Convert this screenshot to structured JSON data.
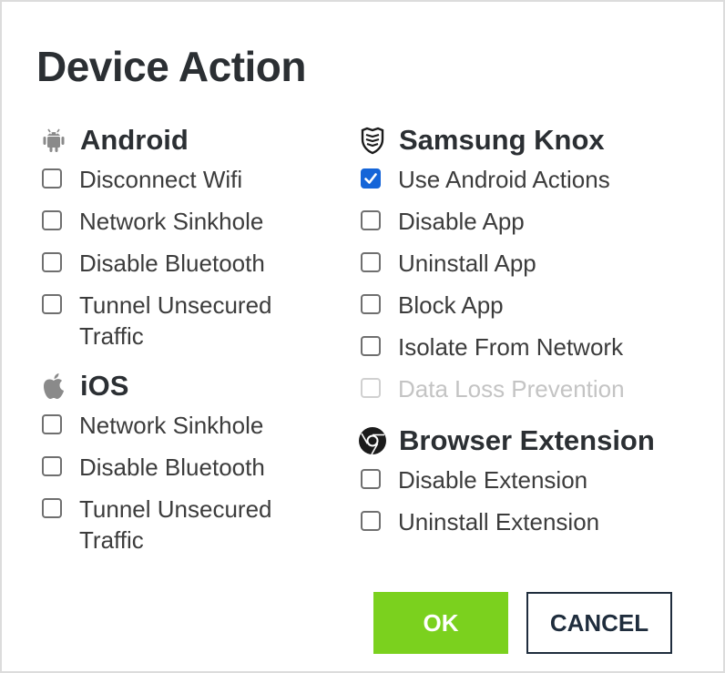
{
  "dialog": {
    "title": "Device Action"
  },
  "android": {
    "title": "Android",
    "icon": "android-icon",
    "items": [
      {
        "label": "Disconnect Wifi",
        "checked": false,
        "disabled": false
      },
      {
        "label": "Network Sinkhole",
        "checked": false,
        "disabled": false
      },
      {
        "label": "Disable Bluetooth",
        "checked": false,
        "disabled": false
      },
      {
        "label": "Tunnel Unsecured Traffic",
        "checked": false,
        "disabled": false
      }
    ]
  },
  "ios": {
    "title": "iOS",
    "icon": "apple-icon",
    "items": [
      {
        "label": "Network Sinkhole",
        "checked": false,
        "disabled": false
      },
      {
        "label": "Disable Bluetooth",
        "checked": false,
        "disabled": false
      },
      {
        "label": "Tunnel Unsecured Traffic",
        "checked": false,
        "disabled": false
      }
    ]
  },
  "knox": {
    "title": "Samsung Knox",
    "icon": "samsung-knox-icon",
    "items": [
      {
        "label": "Use Android Actions",
        "checked": true,
        "disabled": false
      },
      {
        "label": "Disable App",
        "checked": false,
        "disabled": false
      },
      {
        "label": "Uninstall App",
        "checked": false,
        "disabled": false
      },
      {
        "label": "Block App",
        "checked": false,
        "disabled": false
      },
      {
        "label": "Isolate From Network",
        "checked": false,
        "disabled": false
      },
      {
        "label": "Data Loss Prevention",
        "checked": false,
        "disabled": true
      }
    ]
  },
  "browser": {
    "title": "Browser Extension",
    "icon": "chrome-icon",
    "items": [
      {
        "label": "Disable Extension",
        "checked": false,
        "disabled": false
      },
      {
        "label": "Uninstall Extension",
        "checked": false,
        "disabled": false
      }
    ]
  },
  "buttons": {
    "ok_label": "OK",
    "cancel_label": "CANCEL"
  },
  "colors": {
    "ok_button": "#7bd11e",
    "checkbox_checked": "#1565d8",
    "cancel_border": "#1f2d3d",
    "icon_gray": "#8a8a8a"
  }
}
